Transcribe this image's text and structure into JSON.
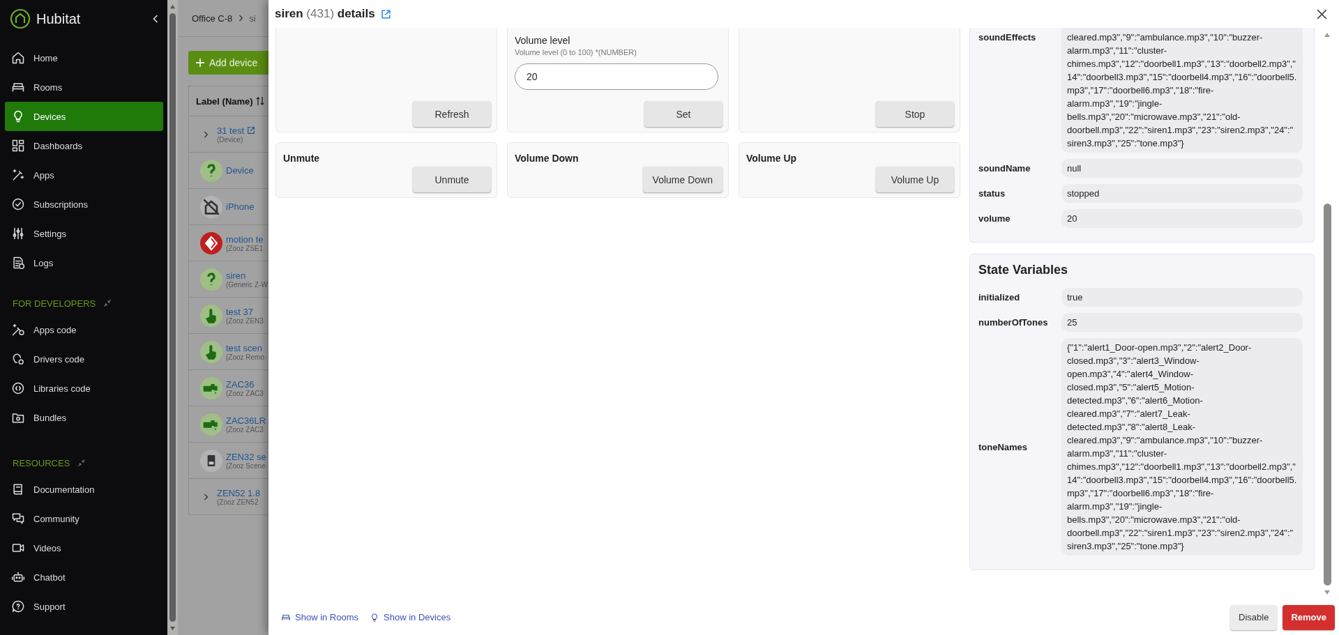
{
  "sidebar": {
    "brand": "Hubitat",
    "items": [
      {
        "label": "Home",
        "selected": false
      },
      {
        "label": "Rooms",
        "selected": false
      },
      {
        "label": "Devices",
        "selected": true
      },
      {
        "label": "Dashboards",
        "selected": false
      },
      {
        "label": "Apps",
        "selected": false
      },
      {
        "label": "Subscriptions",
        "selected": false
      },
      {
        "label": "Settings",
        "selected": false
      },
      {
        "label": "Logs",
        "selected": false
      }
    ],
    "sections": [
      {
        "title": "FOR DEVELOPERS",
        "items": [
          {
            "label": "Apps code",
            "selected": false
          },
          {
            "label": "Drivers code",
            "selected": false
          },
          {
            "label": "Libraries code",
            "selected": false
          },
          {
            "label": "Bundles",
            "selected": false
          }
        ]
      },
      {
        "title": "RESOURCES",
        "items": [
          {
            "label": "Documentation",
            "selected": false
          },
          {
            "label": "Community",
            "selected": false
          },
          {
            "label": "Videos",
            "selected": false
          },
          {
            "label": "Chatbot",
            "selected": false
          },
          {
            "label": "Support",
            "selected": false
          }
        ]
      }
    ]
  },
  "background_page": {
    "breadcrumb": [
      "Office C-8",
      "si"
    ],
    "add_button": "Add device",
    "table": {
      "column": "Label (Name)",
      "rows": [
        {
          "kind": "group",
          "name": "31 test",
          "subtitle": "(Device)"
        },
        {
          "kind": "device",
          "name": "Device",
          "color": "#9fbf86"
        },
        {
          "kind": "device",
          "name": "iPhone",
          "color": "#b3b3b6"
        },
        {
          "kind": "device",
          "name": "motion te",
          "subtitle": "(Zooz ZSE1",
          "color": "#c01e1e"
        },
        {
          "kind": "device",
          "name": "siren",
          "subtitle": "(Generic Z-W",
          "color": "#9fbf86"
        },
        {
          "kind": "device",
          "name": "test 37",
          "subtitle": "(Zooz ZEN3",
          "color": "#9fbf86"
        },
        {
          "kind": "device",
          "name": "test scen",
          "subtitle": "(Zooz Remo",
          "color": "#9fbf86"
        },
        {
          "kind": "device",
          "name": "ZAC36",
          "subtitle": "(Zooz ZAC3",
          "color": "#9fbf86"
        },
        {
          "kind": "device",
          "name": "ZAC36LR",
          "subtitle": "(Zooz ZAC3",
          "color": "#9fbf86"
        },
        {
          "kind": "device",
          "name": "ZEN32 se",
          "subtitle": "(Zooz Scene",
          "color": "#b3b3b6"
        },
        {
          "kind": "group",
          "name": "ZEN52 1.8",
          "subtitle": "(Zooz ZEN52"
        }
      ]
    }
  },
  "device_details": {
    "title": {
      "name": "siren",
      "id": "(431)",
      "suffix": "details"
    },
    "commands": [
      {
        "button": "Refresh"
      },
      {
        "parameter": {
          "label": "Volume level",
          "hint": "Volume level (0 to 100) *(NUMBER)",
          "value": "20"
        },
        "button": "Set"
      },
      {
        "button": "Stop"
      },
      {
        "title": "Unmute",
        "button": "Unmute"
      },
      {
        "title": "Volume Down",
        "button": "Volume Down"
      },
      {
        "title": "Volume Up",
        "button": "Volume Up"
      }
    ],
    "current_states": [
      {
        "name": "soundEffects",
        "value": "cleared.mp3\",\"9\":\"ambulance.mp3\",\"10\":\"buzzer-alarm.mp3\",\"11\":\"cluster-chimes.mp3\",\"12\":\"doorbell1.mp3\",\"13\":\"doorbell2.mp3\",\"14\":\"doorbell3.mp3\",\"15\":\"doorbell4.mp3\",\"16\":\"doorbell5.mp3\",\"17\":\"doorbell6.mp3\",\"18\":\"fire-alarm.mp3\",\"19\":\"jingle-bells.mp3\",\"20\":\"microwave.mp3\",\"21\":\"old-doorbell.mp3\",\"22\":\"siren1.mp3\",\"23\":\"siren2.mp3\",\"24\":\"siren3.mp3\",\"25\":\"tone.mp3\"}"
      },
      {
        "name": "soundName",
        "value": "null"
      },
      {
        "name": "status",
        "value": "stopped"
      },
      {
        "name": "volume",
        "value": "20"
      }
    ],
    "state_variables": {
      "title": "State Variables",
      "rows": [
        {
          "name": "initialized",
          "value": "true"
        },
        {
          "name": "numberOfTones",
          "value": "25"
        },
        {
          "name": "toneNames",
          "value": "{\"1\":\"alert1_Door-open.mp3\",\"2\":\"alert2_Door-closed.mp3\",\"3\":\"alert3_Window-open.mp3\",\"4\":\"alert4_Window-closed.mp3\",\"5\":\"alert5_Motion-detected.mp3\",\"6\":\"alert6_Motion-cleared.mp3\",\"7\":\"alert7_Leak-detected.mp3\",\"8\":\"alert8_Leak-cleared.mp3\",\"9\":\"ambulance.mp3\",\"10\":\"buzzer-alarm.mp3\",\"11\":\"cluster-chimes.mp3\",\"12\":\"doorbell1.mp3\",\"13\":\"doorbell2.mp3\",\"14\":\"doorbell3.mp3\",\"15\":\"doorbell4.mp3\",\"16\":\"doorbell5.mp3\",\"17\":\"doorbell6.mp3\",\"18\":\"fire-alarm.mp3\",\"19\":\"jingle-bells.mp3\",\"20\":\"microwave.mp3\",\"21\":\"old-doorbell.mp3\",\"22\":\"siren1.mp3\",\"23\":\"siren2.mp3\",\"24\":\"siren3.mp3\",\"25\":\"tone.mp3\"}"
        }
      ]
    },
    "links": [
      "Show in Rooms",
      "Show in Devices"
    ],
    "buttons": [
      {
        "label": "Disable",
        "kind": "secondary"
      },
      {
        "label": "Remove",
        "kind": "danger"
      }
    ]
  }
}
